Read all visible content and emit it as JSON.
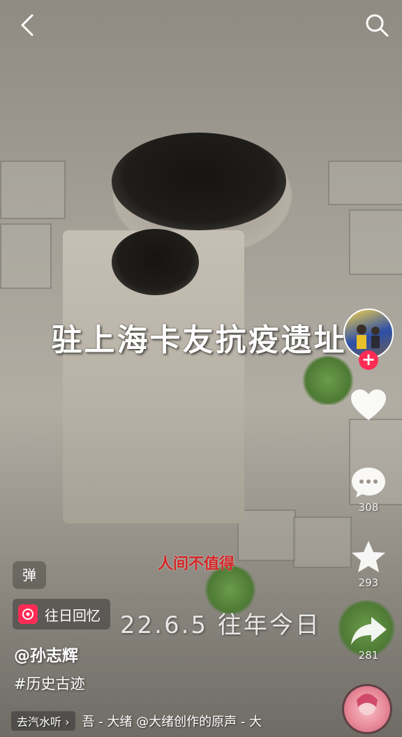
{
  "video": {
    "overlay_caption": "驻上海卡友抗疫遗址",
    "watermark": "人间不值得",
    "date_stamp": "22.6.5 往年今日"
  },
  "actions": {
    "comment_count": "308",
    "favorite_count": "293",
    "share_count": "281"
  },
  "info": {
    "danmu_label": "弹",
    "tag_label": "往日回忆",
    "author": "@孙志辉",
    "hashtag": "#历史古迹",
    "music_chip": "去汽水听 ›",
    "music_text": "吾 - 大绪  @大绪创作的原声 - 大"
  },
  "colors": {
    "accent": "#fe2c55",
    "watermark": "#d42626"
  }
}
